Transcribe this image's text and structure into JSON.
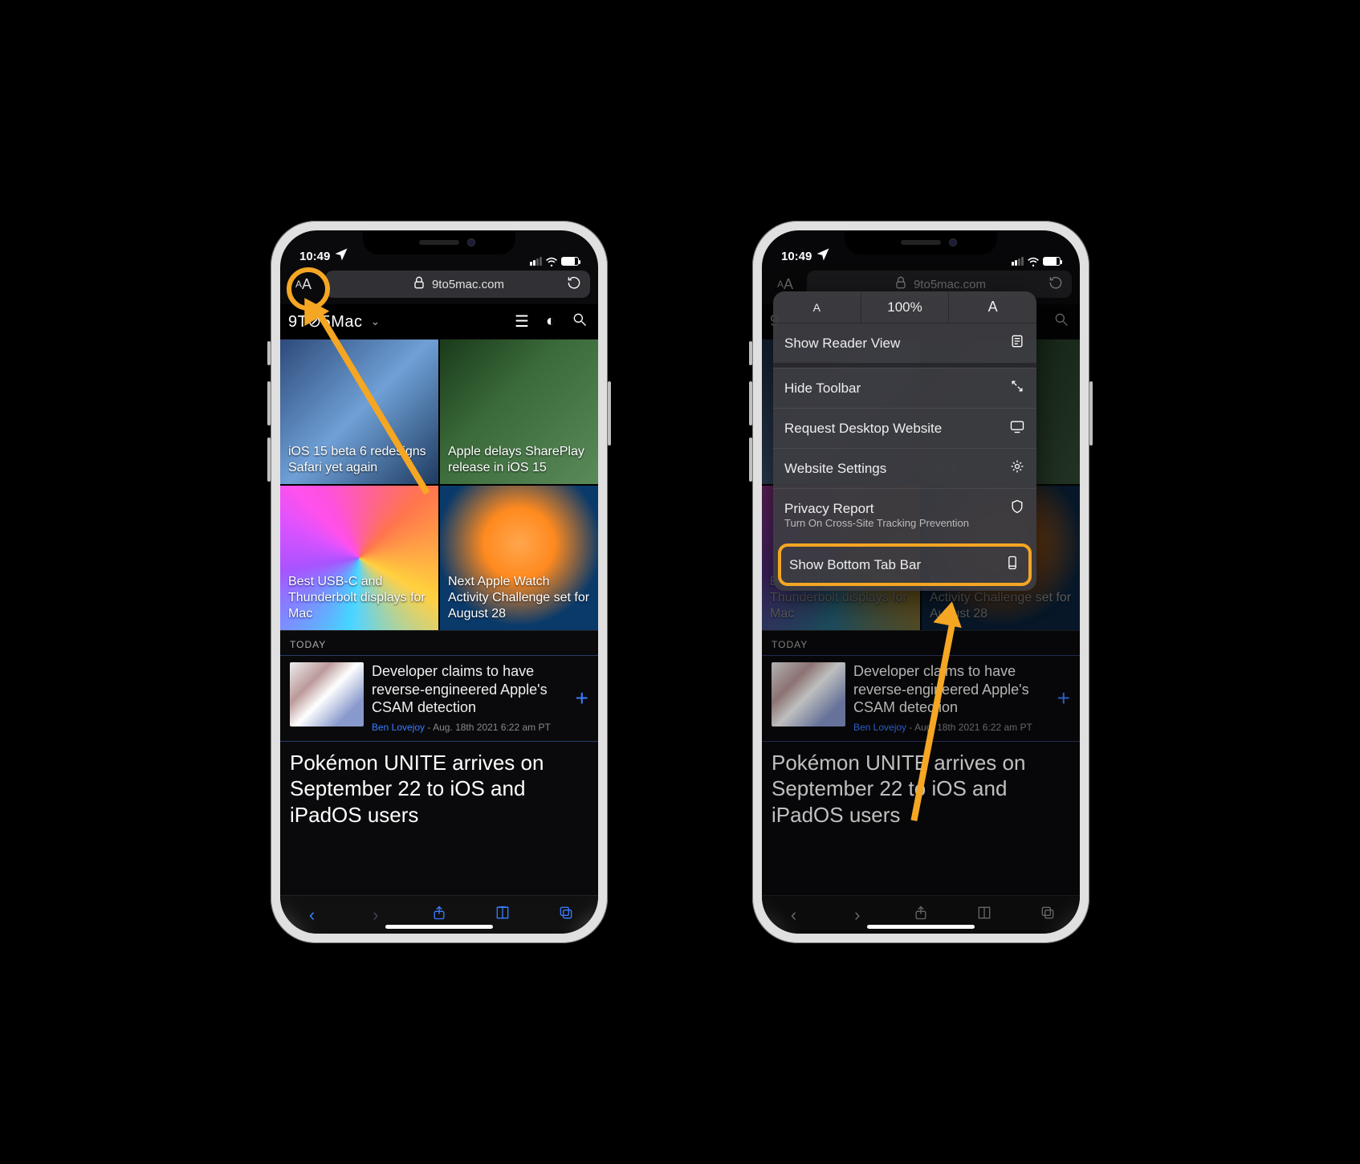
{
  "statusbar": {
    "time": "10:49"
  },
  "addressbar": {
    "domain": "9to5mac.com"
  },
  "site": {
    "name": "9T⊘5Mac"
  },
  "tiles": [
    {
      "caption": "iOS 15 beta 6 redesigns Safari yet again"
    },
    {
      "caption": "Apple delays SharePlay release in iOS 15"
    },
    {
      "caption": "Best USB-C and Thunderbolt displays for Mac"
    },
    {
      "caption": "Next Apple Watch Activity Challenge set for August 28"
    }
  ],
  "section": {
    "today": "TODAY"
  },
  "story1": {
    "title": "Developer claims to have reverse-engineered Apple's CSAM detection",
    "author": "Ben Lovejoy",
    "date": "Aug. 18th 2021 6:22 am PT"
  },
  "story2": {
    "title": "Pokémon UNITE arrives on September 22 to iOS and iPadOS users"
  },
  "menu": {
    "zoom": "100%",
    "reader": "Show Reader View",
    "hideToolbar": "Hide Toolbar",
    "requestDesktop": "Request Desktop Website",
    "websiteSettings": "Website Settings",
    "privacyReport": "Privacy Report",
    "privacySub": "Turn On Cross-Site Tracking Prevention",
    "showBottom": "Show Bottom Tab Bar"
  }
}
